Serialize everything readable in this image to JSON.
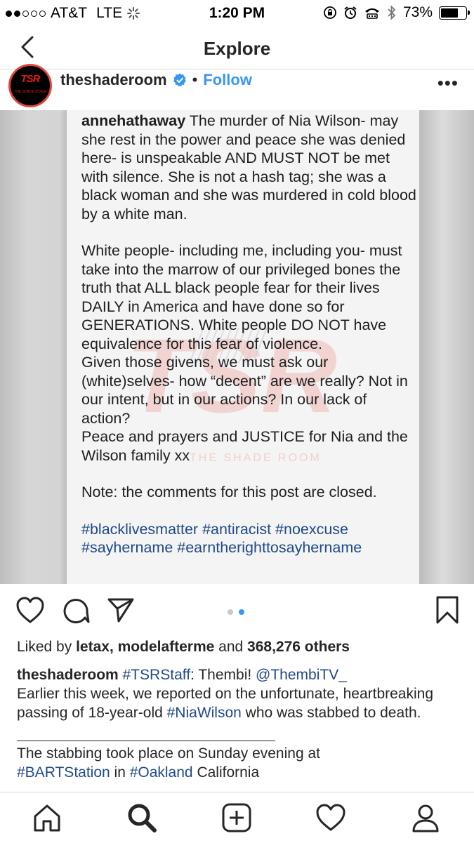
{
  "status_bar": {
    "carrier": "AT&T",
    "network": "LTE",
    "time": "1:20 PM",
    "battery": "73%"
  },
  "nav": {
    "title": "Explore",
    "back_icon": "chevron-left-icon"
  },
  "post_header": {
    "avatar_logo": "TSR",
    "avatar_sub": "THE SHADE ROOM",
    "username": "theshaderoom",
    "separator": "•",
    "follow_label": "Follow",
    "more_label": "•••"
  },
  "post_image": {
    "paragraphs": [
      {
        "user": "annehathaway",
        "text": " The murder of Nia Wilson- may she rest in the power and peace she was denied here- is unspeakable AND MUST NOT be met with silence.  She is not a hash tag; she was a black woman and she was murdered in cold blood by a white man."
      },
      {
        "text": "White people- including me, including you- must take into the marrow of our privileged bones the truth that ALL black people fear for their lives DAILY in America and have done so for GENERATIONS.  White people DO NOT have equivalence for this fear of violence."
      },
      {
        "text": "Given those givens, we must ask our (white)selves- how “decent” are we really?  Not in our intent, but in our actions?  In our lack of action?"
      },
      {
        "text": "Peace and prayers and JUSTICE for Nia and the Wilson family xx"
      },
      {
        "text": "Note: the comments for this post are closed."
      },
      {
        "text": "#blacklivesmatter #antiracist #noexcuse #sayhername #earntherighttosayhername"
      }
    ],
    "watermark_label": "THE SHADE ROOM"
  },
  "pager": {
    "count": 2,
    "active": 2
  },
  "likes": {
    "prefix": "Liked by ",
    "user1": "letax",
    "comma": ", ",
    "user2": "modelafterme",
    "and": " and ",
    "count": "368,276 others"
  },
  "caption": {
    "username": "theshaderoom",
    "tag": "#TSRStaff",
    "colon_text": ": Thembi! ",
    "mention": "@ThembiTV_",
    "line2_prefix": "Earlier this week, we reported on the unfortunate, heartbreaking passing of 18-year-old ",
    "hashtag": "#NiaWilson",
    "line2_suffix": " who was stabbed to death.",
    "line3": "The stabbing took place on Sunday evening at",
    "line4_tag1": "#BARTStation",
    "line4_mid": " in ",
    "line4_tag2": "#Oakland",
    "line4_end": " California"
  },
  "tabs": [
    "home-icon",
    "search-icon",
    "add-post-icon",
    "activity-heart-icon",
    "profile-icon"
  ],
  "colors": {
    "accent_blue": "#3897f0",
    "link_blue": "#1f4a8a",
    "brand_red": "#e21b1b"
  }
}
